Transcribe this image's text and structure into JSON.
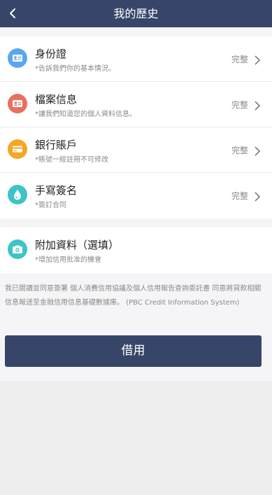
{
  "header": {
    "title": "我的歷史"
  },
  "colors": {
    "header_bg": "#374668",
    "id_icon": "#5aa7f0",
    "profile_icon": "#e8705f",
    "bank_icon": "#f5a623",
    "sign_icon": "#3cc4c6",
    "extra_icon": "#3cc4c6"
  },
  "sections": {
    "required": [
      {
        "icon": "id-card-icon",
        "title": "身份證",
        "subtitle": "*告訴我們你的基本情況。",
        "status": "完整"
      },
      {
        "icon": "profile-icon",
        "title": "檔案信息",
        "subtitle": "*讓我們知道您的個人資料信息。",
        "status": "完整"
      },
      {
        "icon": "bank-card-icon",
        "title": "銀行賬戶",
        "subtitle": "*賬號一經註冊不可修改",
        "status": "完整"
      },
      {
        "icon": "signature-icon",
        "title": "手寫簽名",
        "subtitle": "*簽訂合同",
        "status": "完整"
      }
    ],
    "optional": {
      "icon": "camera-icon",
      "title": "附加資料（選填）",
      "subtitle": "*增加信用批准的機會"
    }
  },
  "terms": {
    "text": "我已閱讀並同意簽署 個人消費信用協議及個人信用報告查詢委託書 同意將貸款相關信息報送至金融信用信息基礎數據庫。 (PBC Credit Information System)"
  },
  "submit": {
    "label": "借用"
  }
}
